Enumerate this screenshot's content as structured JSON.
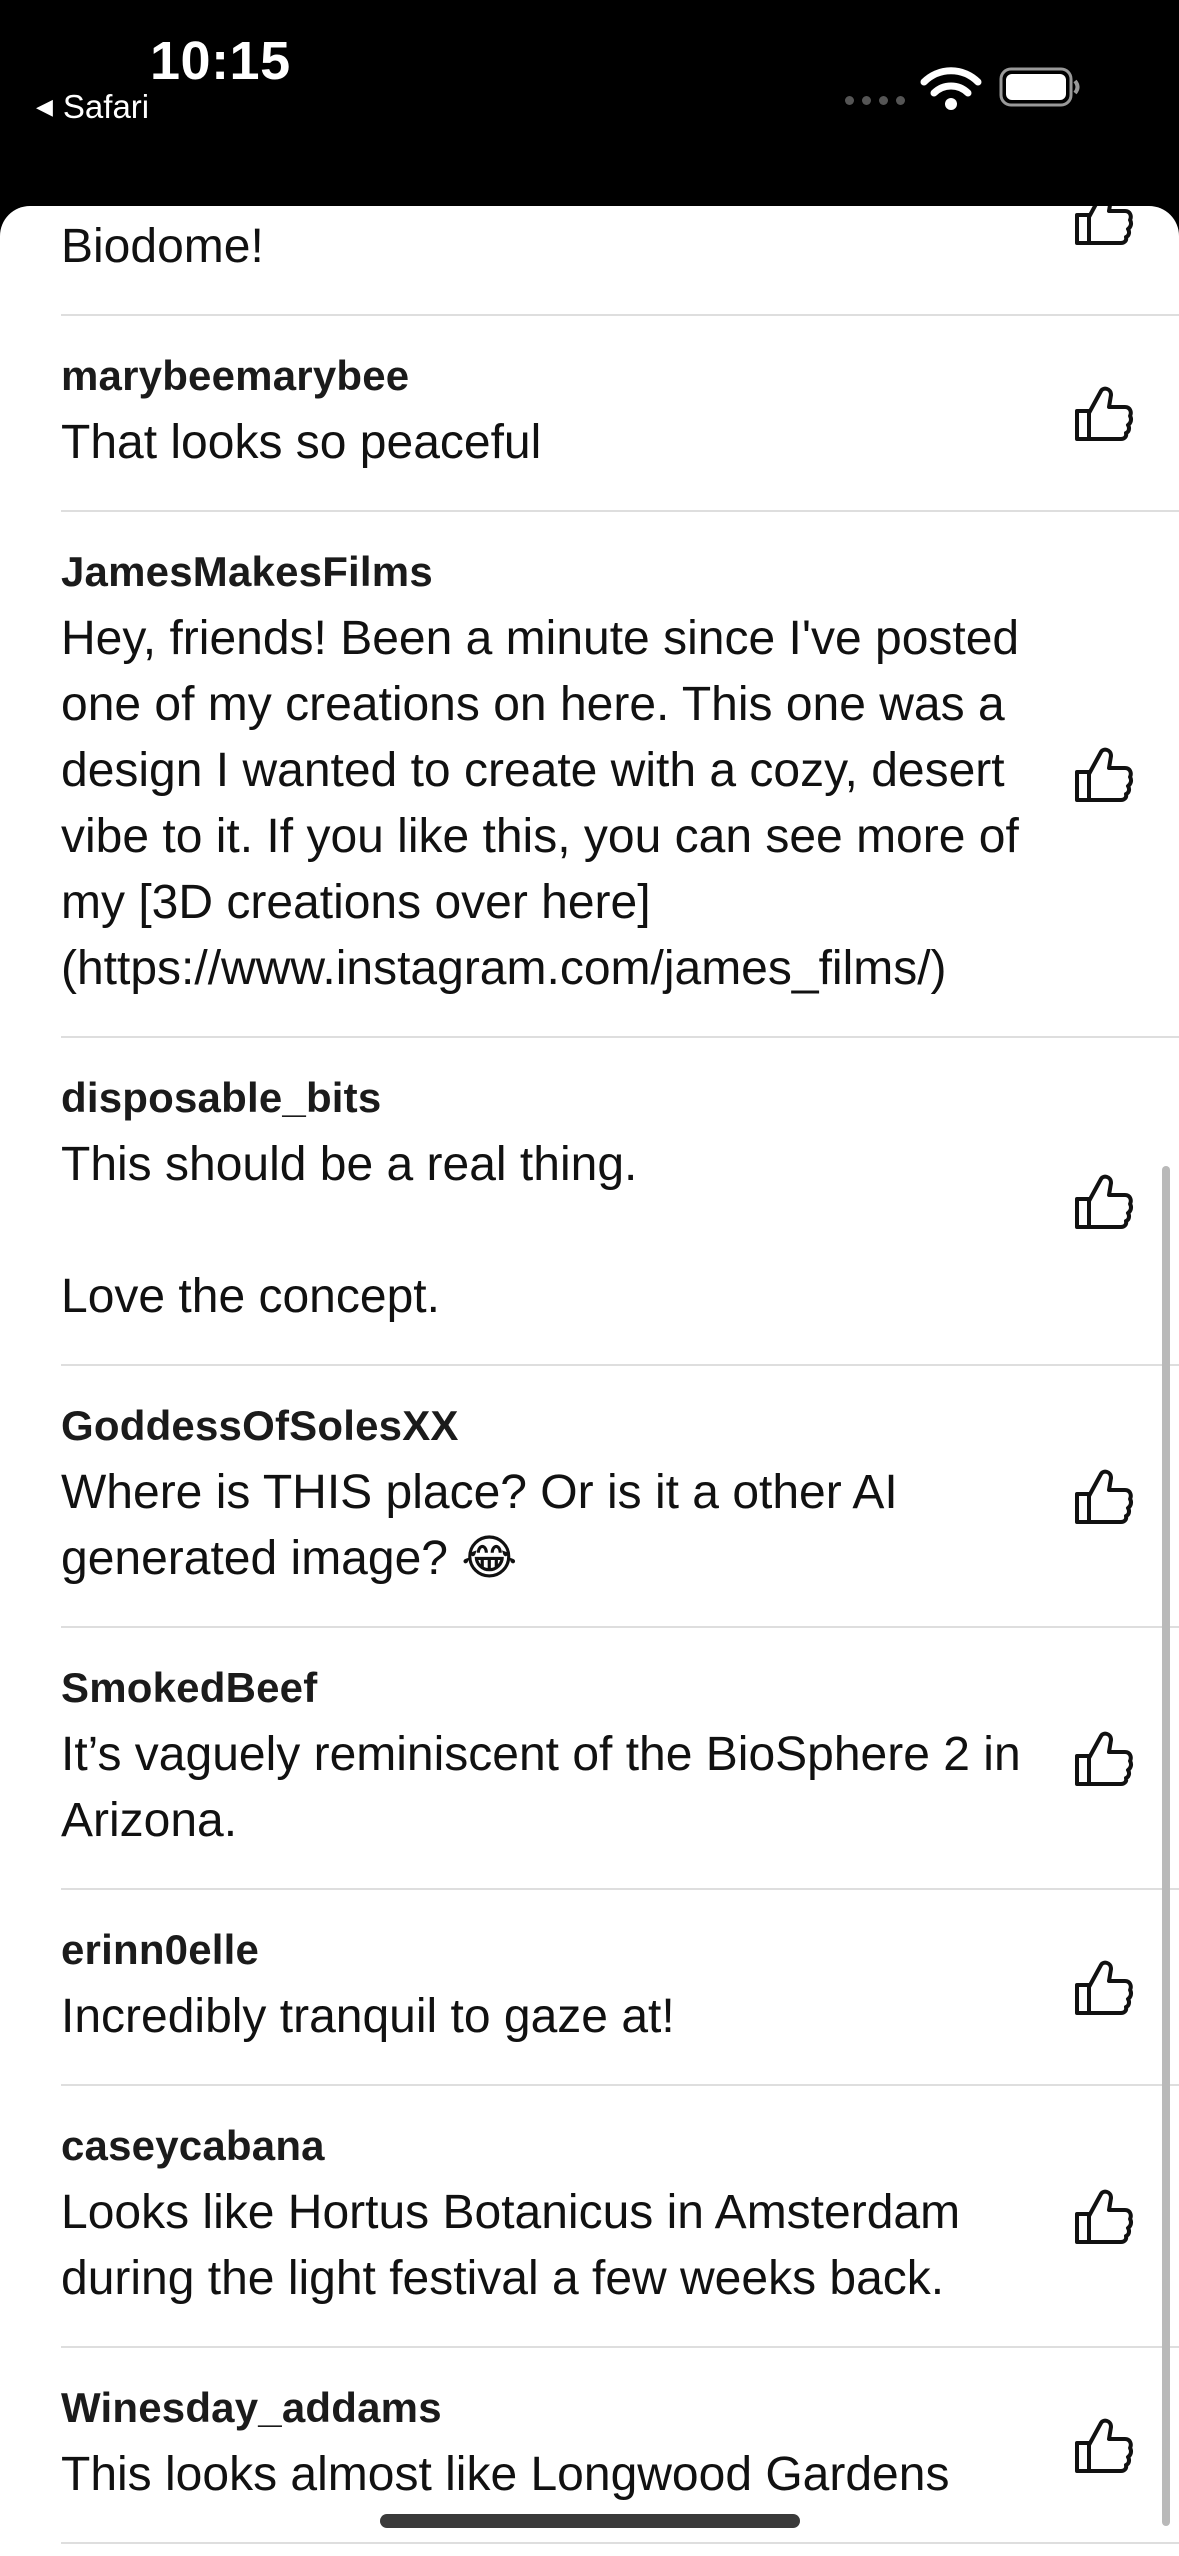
{
  "status_bar": {
    "time": "10:15",
    "back_label": "Safari",
    "back_icon": "triangle-left-icon",
    "signal_icon": "cellular-dots-icon",
    "wifi_icon": "wifi-icon",
    "battery_icon": "battery-icon"
  },
  "like_icon": "thumbs-up-icon",
  "comments": [
    {
      "user": "",
      "text": "Biodome!"
    },
    {
      "user": "marybeemarybee",
      "text": "That looks so peaceful"
    },
    {
      "user": "JamesMakesFilms",
      "text": "Hey, friends! Been a minute since I've posted one of my creations on here. This one was a design I wanted to create with a cozy, desert vibe to it. If you like this, you can see more of my [3D creations over here](https://www.instagram.com/james_films/)"
    },
    {
      "user": "disposable_bits",
      "text": "This should be a real thing.\n\nLove the concept."
    },
    {
      "user": "GoddessOfSolesXX",
      "text": "Where is THIS place? Or is it a other AI generated image? 😂"
    },
    {
      "user": "SmokedBeef",
      "text": "It’s vaguely reminiscent of the BioSphere 2 in Arizona."
    },
    {
      "user": "erinn0elle",
      "text": "Incredibly tranquil to gaze at!"
    },
    {
      "user": "caseycabana",
      "text": "Looks like Hortus Botanicus in Amsterdam during the light festival a few weeks back."
    },
    {
      "user": "Winesday_addams",
      "text": "This looks almost like Longwood Gardens"
    }
  ]
}
